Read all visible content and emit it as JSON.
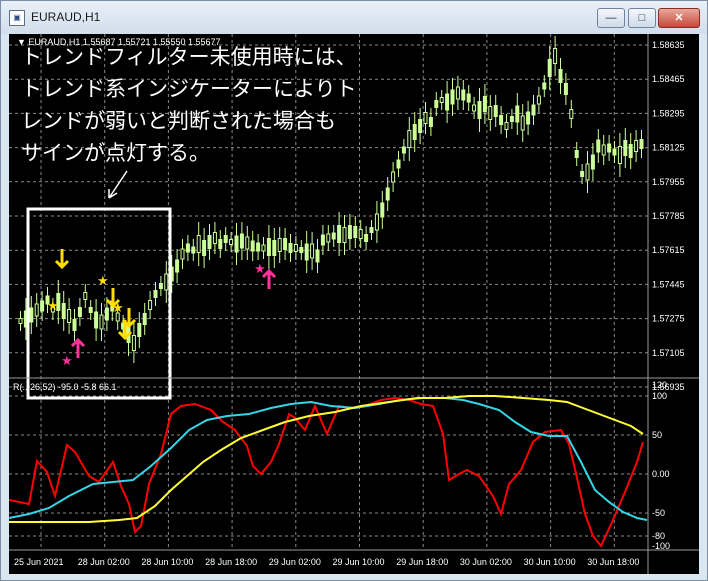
{
  "window": {
    "title": "EURAUD,H1",
    "icon": "chart-window-icon",
    "controls": {
      "minimize": "—",
      "maximize": "□",
      "close": "✕"
    }
  },
  "chart": {
    "info": "▼ EURAUD,H1  1.55687 1.55721 1.55550 1.55677",
    "annotation": [
      "トレンドフィルター未使用時には、",
      "トレンド系インジケーターによりト",
      "レンドが弱いと判断された場合も",
      "サインが点灯する。"
    ],
    "price_axis": [
      "1.58635",
      "1.58465",
      "1.58295",
      "1.58125",
      "1.57955",
      "1.57785",
      "1.57615",
      "1.57445",
      "1.57275",
      "1.57105",
      "1.56935"
    ],
    "time_axis": [
      "25 Jun 2021",
      "28 Jun 02:00",
      "28 Jun 10:00",
      "28 Jun 18:00",
      "29 Jun 02:00",
      "29 Jun 10:00",
      "29 Jun 18:00",
      "30 Jun 02:00",
      "30 Jun 10:00",
      "30 Jun 18:00"
    ],
    "indicator_info": "R(..,26,52) -95.0 -5.8 66.1",
    "indicator_axis": [
      "120",
      "100",
      "50",
      "0.00",
      "-50",
      "-80",
      "-100"
    ],
    "colors": {
      "bg": "#000000",
      "candle": "#ccff99",
      "grid": "#8a8a8a",
      "line_red": "#ff0000",
      "line_cyan": "#33d6e6",
      "line_yellow": "#ffff33",
      "sell_arrow": "#ffdd00",
      "buy_arrow": "#ff3399",
      "box": "#ffffff"
    }
  }
}
